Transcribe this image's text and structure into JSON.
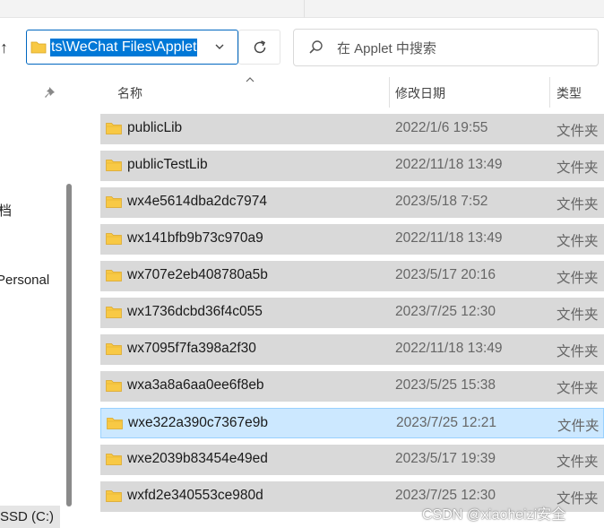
{
  "address_bar": {
    "path": "ts\\WeChat Files\\Applet"
  },
  "search": {
    "placeholder": "在 Applet 中搜索"
  },
  "nav_pane": {
    "items": [
      {
        "label": "档"
      },
      {
        "label": "Personal"
      },
      {
        "label": "SSD (C:)"
      }
    ]
  },
  "columns": {
    "name": "名称",
    "date": "修改日期",
    "type": "类型"
  },
  "files": [
    {
      "name": "publicLib",
      "date": "2022/1/6 19:55",
      "type": "文件夹",
      "selected": false
    },
    {
      "name": "publicTestLib",
      "date": "2022/11/18 13:49",
      "type": "文件夹",
      "selected": false
    },
    {
      "name": "wx4e5614dba2dc7974",
      "date": "2023/5/18 7:52",
      "type": "文件夹",
      "selected": false
    },
    {
      "name": "wx141bfb9b73c970a9",
      "date": "2022/11/18 13:49",
      "type": "文件夹",
      "selected": false
    },
    {
      "name": "wx707e2eb408780a5b",
      "date": "2023/5/17 20:16",
      "type": "文件夹",
      "selected": false
    },
    {
      "name": "wx1736dcbd36f4c055",
      "date": "2023/7/25 12:30",
      "type": "文件夹",
      "selected": false
    },
    {
      "name": "wx7095f7fa398a2f30",
      "date": "2022/11/18 13:49",
      "type": "文件夹",
      "selected": false
    },
    {
      "name": "wxa3a8a6aa0ee6f8eb",
      "date": "2023/5/25 15:38",
      "type": "文件夹",
      "selected": false
    },
    {
      "name": "wxe322a390c7367e9b",
      "date": "2023/7/25 12:21",
      "type": "文件夹",
      "selected": true
    },
    {
      "name": "wxe2039b83454e49ed",
      "date": "2023/5/17 19:39",
      "type": "文件夹",
      "selected": false
    },
    {
      "name": "wxfd2e340553ce980d",
      "date": "2023/7/25 12:30",
      "type": "文件夹",
      "selected": false
    }
  ],
  "watermark": "CSDN @xiaoheizi安全",
  "colors": {
    "accent": "#0078d7",
    "row_bg": "#d9d9d9",
    "selected_row_bg": "#cce8ff",
    "folder_yellow": "#f8c945"
  }
}
